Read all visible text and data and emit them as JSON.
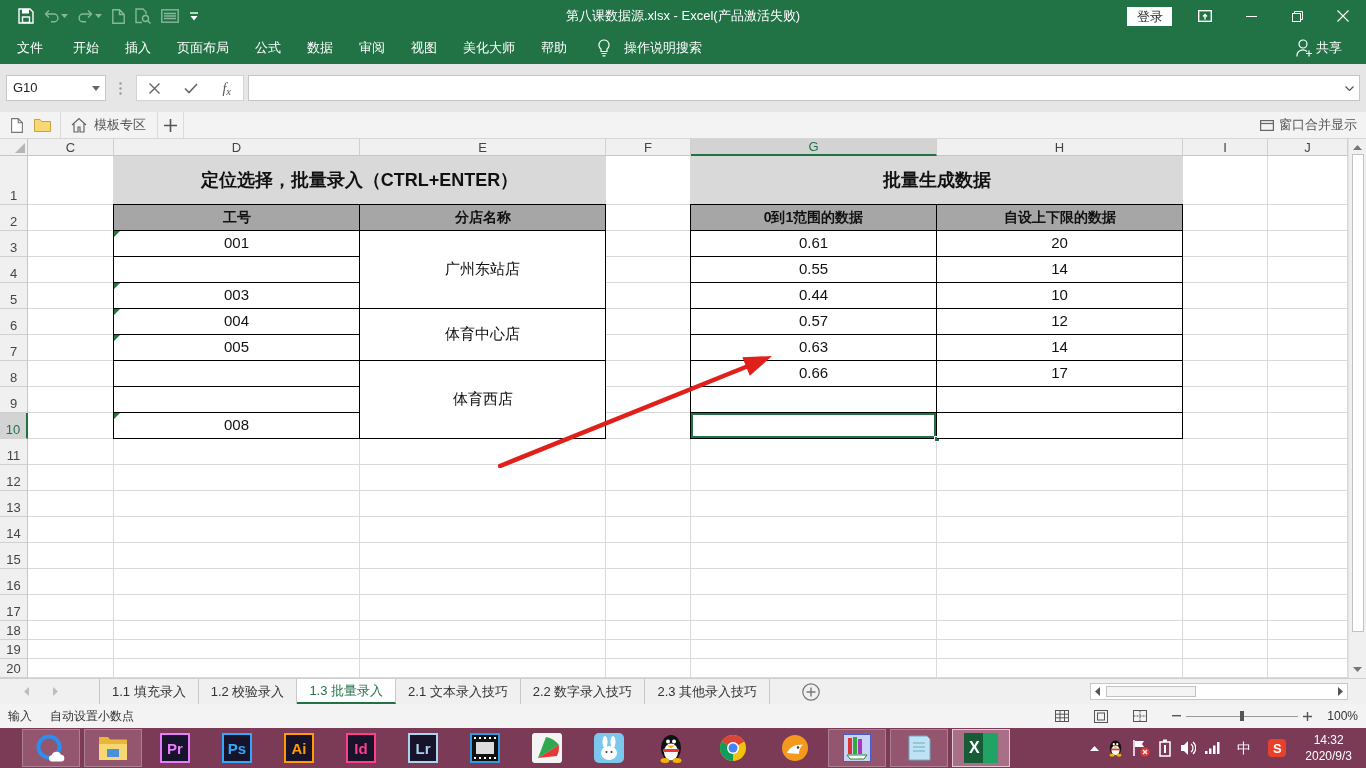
{
  "window": {
    "title": "第八课数据源.xlsx - Excel(产品激活失败)",
    "login": "登录"
  },
  "quick_access": [
    {
      "kind": "save",
      "disabled": false
    },
    {
      "kind": "undo",
      "disabled": true
    },
    {
      "kind": "redo",
      "disabled": true
    },
    {
      "kind": "new",
      "disabled": true
    },
    {
      "kind": "preview",
      "disabled": true
    },
    {
      "kind": "form",
      "disabled": true
    },
    {
      "kind": "customize",
      "disabled": false
    }
  ],
  "ribbon": {
    "tabs": [
      {
        "label": "文件",
        "selected": false
      },
      {
        "label": "开始",
        "selected": false
      },
      {
        "label": "插入",
        "selected": false
      },
      {
        "label": "页面布局",
        "selected": false
      },
      {
        "label": "公式",
        "selected": false
      },
      {
        "label": "数据",
        "selected": false
      },
      {
        "label": "审阅",
        "selected": false
      },
      {
        "label": "视图",
        "selected": false
      },
      {
        "label": "美化大师",
        "selected": false
      },
      {
        "label": "帮助",
        "selected": false
      }
    ],
    "tell_me": "操作说明搜索",
    "share": "共享"
  },
  "formula_bar": {
    "name_box": "G10",
    "function_button": "f$_{x}$"
  },
  "addin_bar": {
    "template_tab": "模板专区",
    "merge_windows": "窗口合并显示"
  },
  "sheet": {
    "columns": [
      {
        "label": "C",
        "selected": false
      },
      {
        "label": "D",
        "selected": false
      },
      {
        "label": "E",
        "selected": false
      },
      {
        "label": "F",
        "selected": false
      },
      {
        "label": "G",
        "selected": true
      },
      {
        "label": "H",
        "selected": false
      },
      {
        "label": "I",
        "selected": false
      },
      {
        "label": "J",
        "selected": false
      }
    ],
    "rows": [
      {
        "label": "1",
        "selected": false
      },
      {
        "label": "2",
        "selected": false
      },
      {
        "label": "3",
        "selected": false
      },
      {
        "label": "4",
        "selected": false
      },
      {
        "label": "5",
        "selected": false
      },
      {
        "label": "6",
        "selected": false
      },
      {
        "label": "7",
        "selected": false
      },
      {
        "label": "8",
        "selected": false
      },
      {
        "label": "9",
        "selected": false
      },
      {
        "label": "10",
        "selected": true
      },
      {
        "label": "11",
        "selected": false
      },
      {
        "label": "12",
        "selected": false
      },
      {
        "label": "13",
        "selected": false
      },
      {
        "label": "14",
        "selected": false
      },
      {
        "label": "15",
        "selected": false
      },
      {
        "label": "16",
        "selected": false
      },
      {
        "label": "17",
        "selected": false
      },
      {
        "label": "18",
        "selected": false
      },
      {
        "label": "19",
        "selected": false
      },
      {
        "label": "20",
        "selected": false
      }
    ],
    "left_table": {
      "title": "定位选择，批量录入（CTRL+ENTER）",
      "headers": [
        "工号",
        "分店名称"
      ],
      "groups": [
        {
          "store": "广州东站店",
          "selected": false,
          "ids": [
            {
              "value": "001",
              "marked": true,
              "selected": false
            },
            {
              "marked": false,
              "selected": false
            },
            {
              "value": "003",
              "marked": true,
              "selected": false
            }
          ]
        },
        {
          "store": "体育中心店",
          "selected": false,
          "ids": [
            {
              "value": "004",
              "marked": true,
              "selected": false
            },
            {
              "value": "005",
              "marked": true,
              "selected": false
            }
          ]
        },
        {
          "store": "体育西店",
          "selected": false,
          "ids": [
            {
              "marked": false,
              "selected": false
            },
            {
              "marked": false,
              "selected": false
            },
            {
              "value": "008",
              "marked": true,
              "selected": false
            }
          ]
        }
      ]
    },
    "right_table": {
      "title": "批量生成数据",
      "headers": [
        "0到1范围的数据",
        "自设上下限的数据"
      ],
      "rows": [
        {
          "cells": [
            {
              "value": "0.61",
              "selected": false
            },
            {
              "value": "20",
              "selected": false
            }
          ]
        },
        {
          "cells": [
            {
              "value": "0.55",
              "selected": false
            },
            {
              "value": "14",
              "selected": false
            }
          ]
        },
        {
          "cells": [
            {
              "value": "0.44",
              "selected": false
            },
            {
              "value": "10",
              "selected": false
            }
          ]
        },
        {
          "cells": [
            {
              "value": "0.57",
              "selected": false
            },
            {
              "value": "12",
              "selected": false
            }
          ]
        },
        {
          "cells": [
            {
              "value": "0.63",
              "selected": false
            },
            {
              "value": "14",
              "selected": false
            }
          ]
        },
        {
          "cells": [
            {
              "value": "0.66",
              "selected": false
            },
            {
              "value": "17",
              "selected": false
            }
          ]
        },
        {
          "cells": [
            {
              "selected": false
            },
            {
              "selected": false
            }
          ]
        },
        {
          "cells": [
            {
              "selected": true
            },
            {
              "selected": false
            }
          ]
        }
      ]
    }
  },
  "sheet_tabs": {
    "nav_disabled": true,
    "tabs": [
      {
        "label": "1.1 填充录入",
        "selected": false
      },
      {
        "label": "1.2 校验录入",
        "selected": false
      },
      {
        "label": "1.3 批量录入",
        "selected": true
      },
      {
        "label": "2.1 文本录入技巧",
        "selected": false
      },
      {
        "label": "2.2 数字录入技巧",
        "selected": false
      },
      {
        "label": "2.3 其他录入技巧",
        "selected": false
      }
    ]
  },
  "status_bar": {
    "mode": "输入",
    "fixed_decimal": "自动设置小数点",
    "zoom": {
      "level": 0.5,
      "reading": "100%"
    }
  },
  "taskbar": {
    "apps": [
      {
        "kind": "browser",
        "running": true,
        "selected": false
      },
      {
        "kind": "explorer",
        "running": true,
        "selected": false
      },
      {
        "kind": "logo",
        "text": "Pr",
        "color": "#e77bff",
        "running": false,
        "selected": false
      },
      {
        "kind": "logo",
        "text": "Ps",
        "color": "#31a8ff",
        "running": false,
        "selected": false
      },
      {
        "kind": "logo",
        "text": "Ai",
        "color": "#ff9a00",
        "running": false,
        "selected": false
      },
      {
        "kind": "logo",
        "text": "Id",
        "color": "#ff3d8b",
        "running": false,
        "selected": false
      },
      {
        "kind": "logo",
        "text": "Lr",
        "color": "#a9d4f0",
        "running": false,
        "selected": false
      },
      {
        "kind": "film",
        "running": false,
        "selected": false
      },
      {
        "kind": "fan",
        "running": false,
        "selected": false
      },
      {
        "kind": "rabbit",
        "running": false,
        "selected": false
      },
      {
        "kind": "penguin",
        "running": false,
        "selected": false
      },
      {
        "kind": "wheel",
        "running": false,
        "selected": false
      },
      {
        "kind": "cat",
        "running": false,
        "selected": false
      },
      {
        "kind": "books",
        "running": true,
        "selected": false
      },
      {
        "kind": "notepad",
        "running": true,
        "selected": false
      },
      {
        "kind": "excel",
        "text": "X",
        "running": true,
        "selected": true
      }
    ],
    "tray": {
      "ime": "中",
      "logo": "S",
      "time": "14:32",
      "date": "2020/9/3"
    }
  }
}
